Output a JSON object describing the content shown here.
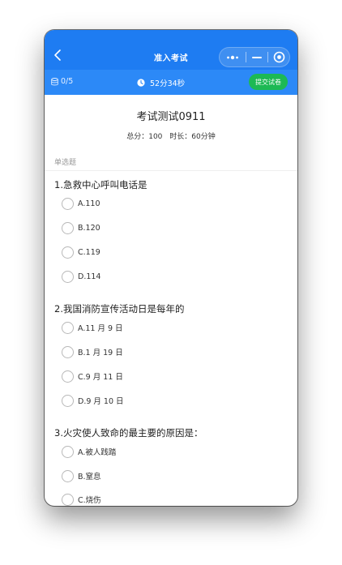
{
  "nav": {
    "title": "准入考试"
  },
  "status": {
    "progress": "0/5",
    "time_left": "52分34秒",
    "submit_label": "提交试卷"
  },
  "exam": {
    "title": "考试测试0911",
    "score_text": "总分：100",
    "duration_text": "时长：60分钟"
  },
  "section": {
    "label": "单选题"
  },
  "questions": [
    {
      "text": "1.急救中心呼叫电话是",
      "options": [
        "A.110",
        "B.120",
        "C.119",
        "D.114"
      ]
    },
    {
      "text": "2.我国消防宣传活动日是每年的",
      "options": [
        "A.11 月 9 日",
        "B.1 月 19 日",
        "C.9 月 11 日",
        "D.9 月 10 日"
      ]
    },
    {
      "text": "3.火灾使人致命的最主要的原因是：",
      "options": [
        "A.被人践踏",
        "B.窒息",
        "C.烧伤"
      ]
    }
  ],
  "colors": {
    "nav_bg": "#1E7CF2",
    "status_bg": "#2C89F7",
    "submit_bg": "#1DB954"
  },
  "icons": {
    "back": "chevron-left-icon",
    "more": "more-dots-icon",
    "minimize": "minus-icon",
    "close": "target-close-icon",
    "progress": "database-icon",
    "timer": "clock-icon"
  }
}
